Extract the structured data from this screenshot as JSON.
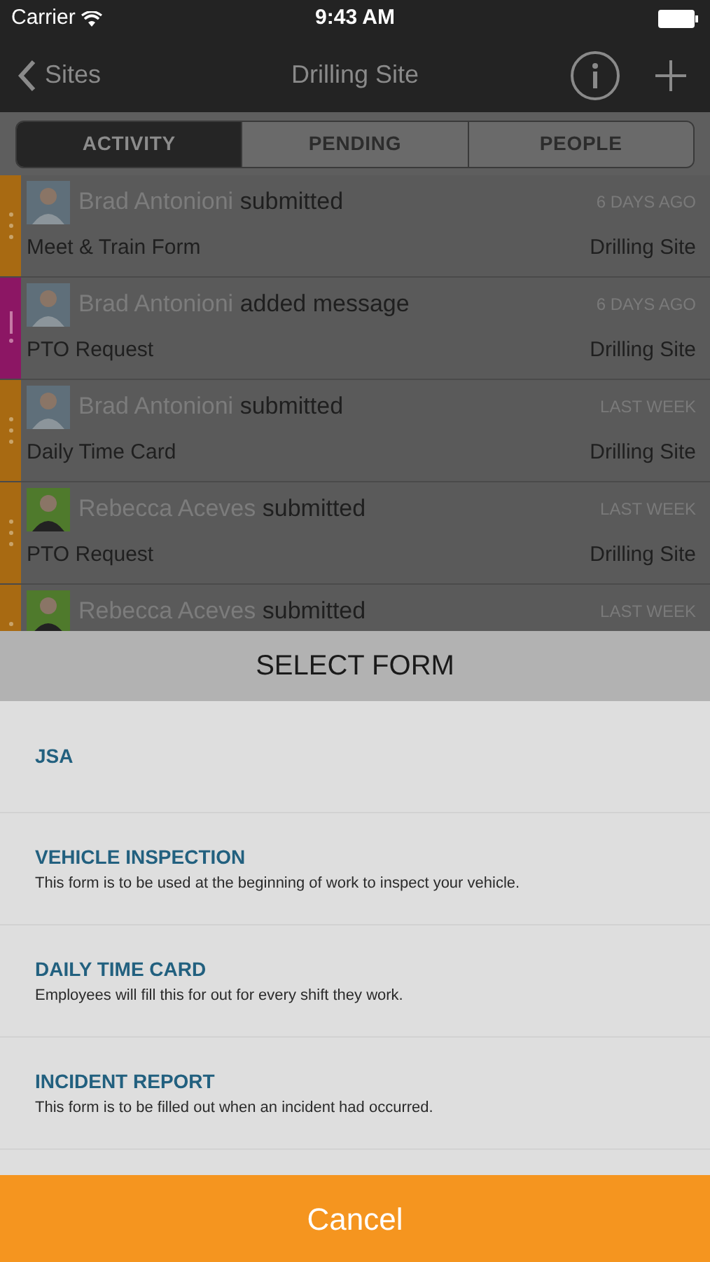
{
  "status_bar": {
    "carrier": "Carrier",
    "time": "9:43 AM"
  },
  "nav": {
    "back": "Sites",
    "title": "Drilling Site"
  },
  "tabs": [
    {
      "label": "ACTIVITY",
      "selected": true
    },
    {
      "label": "PENDING",
      "selected": false
    },
    {
      "label": "PEOPLE",
      "selected": false
    }
  ],
  "activity": [
    {
      "name": "Brad Antonioni",
      "action": "submitted",
      "time": "6 DAYS AGO",
      "form": "Meet & Train Form",
      "site": "Drilling Site",
      "color": "#a86a12",
      "marker": {
        "kind": "dots"
      },
      "avatar": {
        "kind": "man"
      }
    },
    {
      "name": "Brad Antonioni",
      "action": "added message",
      "time": "6 DAYS AGO",
      "form": "PTO Request",
      "site": "Drilling Site",
      "color": "#8c1664",
      "marker": {
        "kind": "alert"
      },
      "avatar": {
        "kind": "man"
      }
    },
    {
      "name": "Brad Antonioni",
      "action": "submitted",
      "time": "LAST WEEK",
      "form": "Daily Time Card",
      "site": "Drilling Site",
      "color": "#a86a12",
      "marker": {
        "kind": "dots"
      },
      "avatar": {
        "kind": "man"
      }
    },
    {
      "name": "Rebecca Aceves",
      "action": "submitted",
      "time": "LAST WEEK",
      "form": "PTO Request",
      "site": "Drilling Site",
      "color": "#a86a12",
      "marker": {
        "kind": "dots"
      },
      "avatar": {
        "kind": "woman"
      }
    },
    {
      "name": "Rebecca Aceves",
      "action": "submitted",
      "time": "LAST WEEK",
      "color": "#a86a12",
      "marker": {
        "kind": "dots"
      },
      "avatar": {
        "kind": "woman"
      }
    }
  ],
  "sheet": {
    "title": "SELECT FORM",
    "forms": [
      {
        "name": "JSA"
      },
      {
        "name": "VEHICLE INSPECTION",
        "description": "This form is to be used at the beginning of work to inspect your vehicle."
      },
      {
        "name": "DAILY TIME CARD",
        "description": "Employees will fill this for out for every shift they work."
      },
      {
        "name": "INCIDENT REPORT",
        "description": "This form is to be filled out when an incident had occurred."
      }
    ],
    "cancel": "Cancel"
  }
}
